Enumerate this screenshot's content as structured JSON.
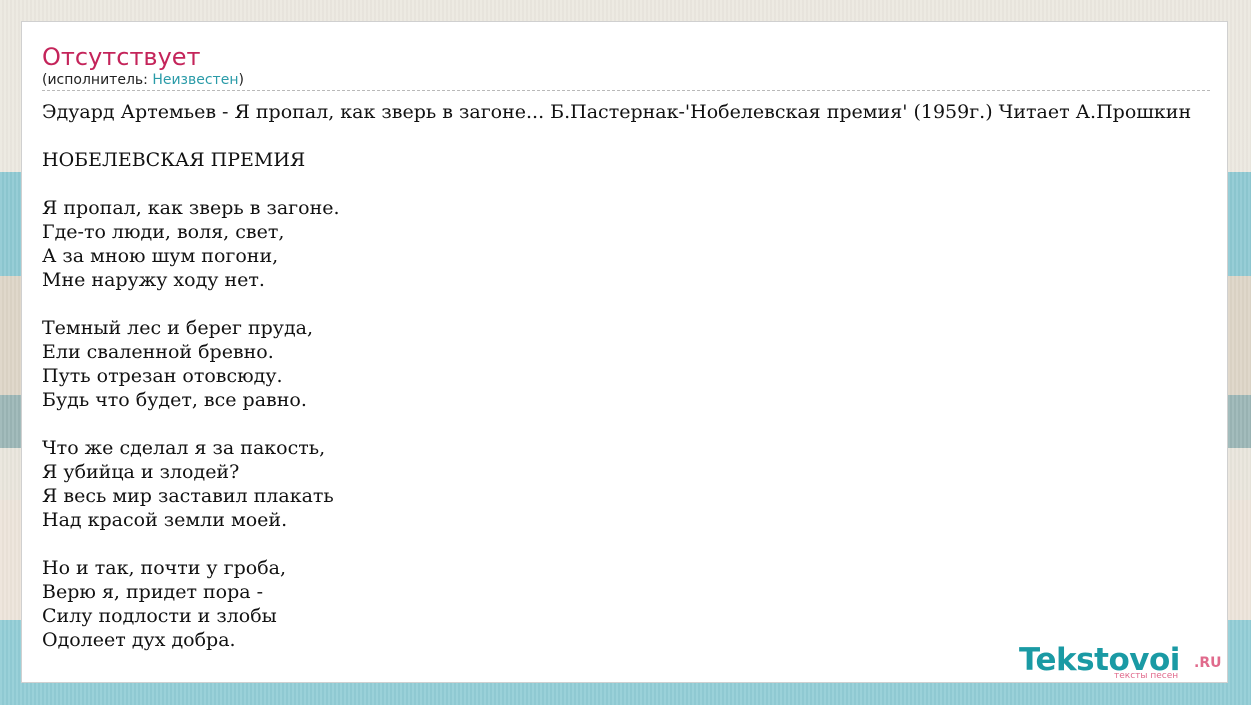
{
  "page": {
    "title": "Отсутствует",
    "performer_prefix": "(исполнитель: ",
    "performer_name": "Неизвестен",
    "performer_suffix": ")"
  },
  "lyrics": {
    "text": "Эдуард Артемьев - Я пропал, как зверь в загоне... Б.Пастернак-'Нобелевская премия' (1959г.) Читает А.Прошкин\n\nНОБЕЛЕВСКАЯ ПРЕМИЯ\n\nЯ пропал, как зверь в загоне.\nГде-то люди, воля, свет,\nА за мною шум погони,\nМне наружу ходу нет.\n\nТемный лес и берег пруда,\nЕли сваленной бревно.\nПуть отрезан отовсюду.\nБудь что будет, все равно.\n\nЧто же сделал я за пакость,\nЯ убийца и злодей?\nЯ весь мир заставил плакать\nНад красой земли моей.\n\nНо и так, почти у гроба,\nВерю я, придет пора -\nСилу подлости и злобы\nОдолеет дух добра."
  },
  "logo": {
    "main": "Tekstovoi",
    "tld": ".RU",
    "tagline": "тексты песен"
  },
  "colors": {
    "title": "#c4245a",
    "link": "#2a9ba8",
    "logo_main": "#1a9aa4",
    "logo_accent": "#e06a8c"
  }
}
